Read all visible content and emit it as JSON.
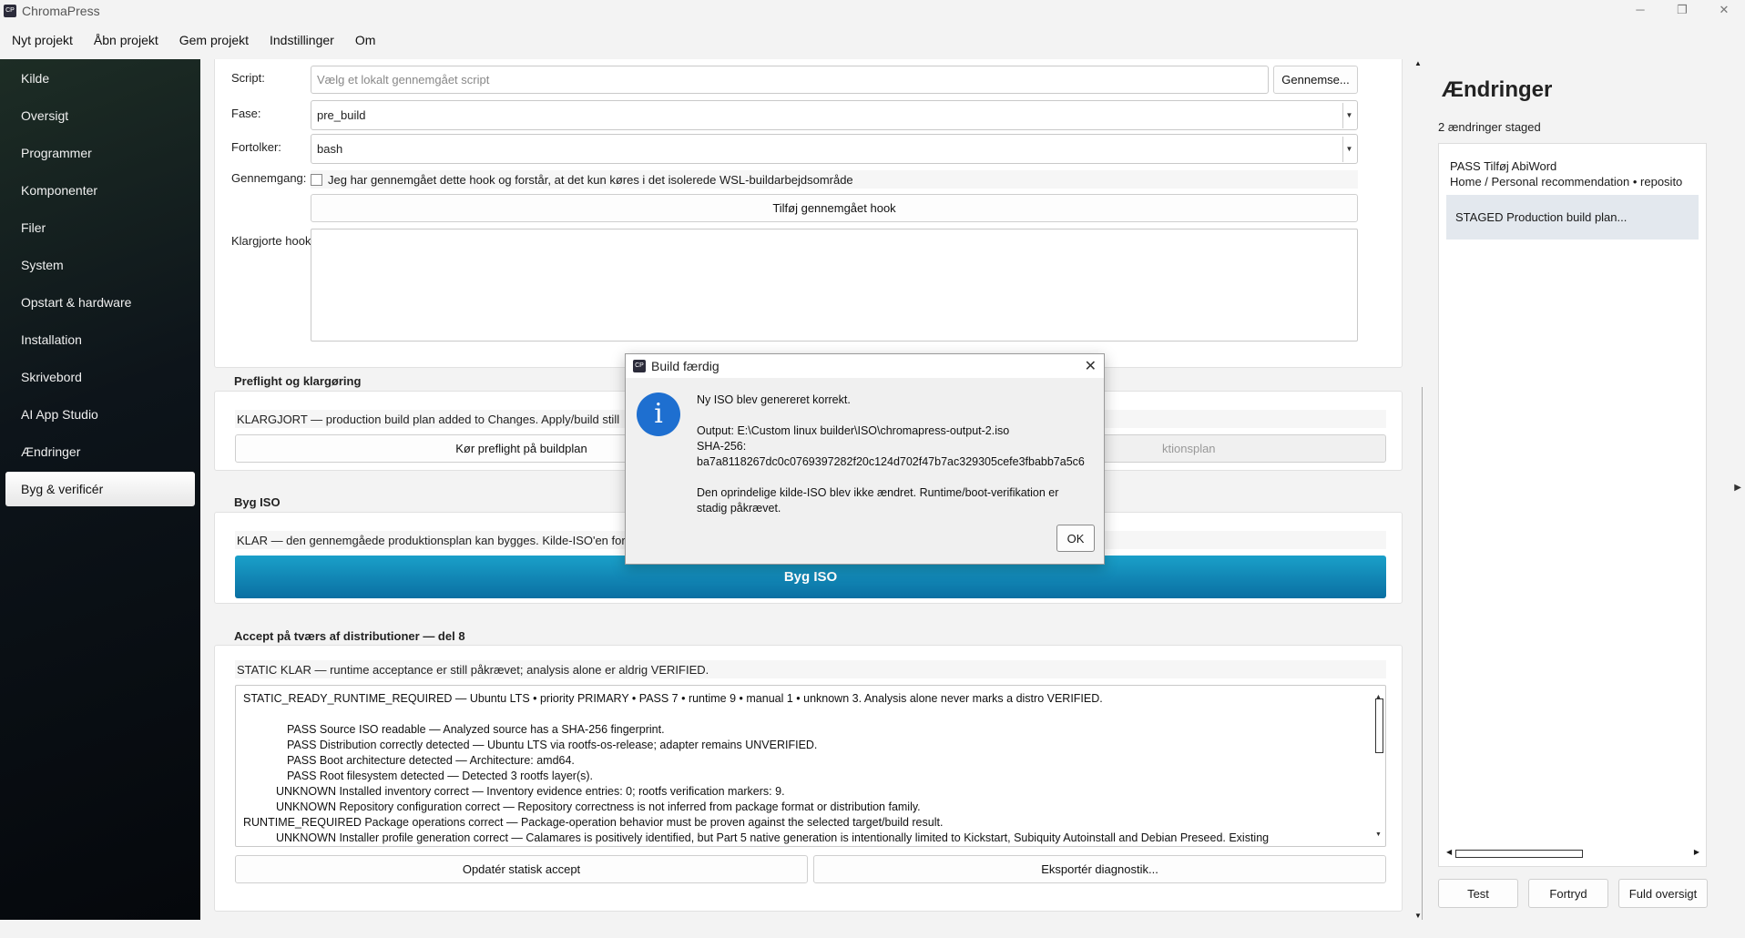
{
  "window": {
    "title": "ChromaPress",
    "controls": [
      "─",
      "❐",
      "✕"
    ]
  },
  "menu": [
    "Nyt projekt",
    "Åbn projekt",
    "Gem projekt",
    "Indstillinger",
    "Om"
  ],
  "sidebar": {
    "items": [
      "Kilde",
      "Oversigt",
      "Programmer",
      "Komponenter",
      "Filer",
      "System",
      "Opstart & hardware",
      "Installation",
      "Skrivebord",
      "AI App Studio",
      "Ændringer",
      "Byg & verificér"
    ],
    "active": "Byg & verificér"
  },
  "hooks": {
    "script_label": "Script:",
    "script_placeholder": "Vælg et lokalt gennemgået script",
    "browse_button": "Gennemse...",
    "phase_label": "Fase:",
    "phase_value": "pre_build",
    "interpreter_label": "Fortolker:",
    "interpreter_value": "bash",
    "review_label": "Gennemgang:",
    "review_checkbox": "Jeg har gennemgået dette hook og forstår, at det kun køres i det isolerede WSL-buildarbejdsområde",
    "add_button": "Tilføj gennemgået hook",
    "prepared_label": "Klargjorte hooks:"
  },
  "preflight": {
    "title": "Preflight og klargøring",
    "status": "KLARGJORT — production build plan added to Changes. Apply/build still",
    "run_button": "Kør preflight på buildplan",
    "plan_button_partial": "ktionsplan"
  },
  "build": {
    "title": "Byg ISO",
    "status": "KLAR — den gennemgåede produktionsplan kan bygges. Kilde-ISO'en for",
    "button": "Byg ISO"
  },
  "accept": {
    "title": "Accept på tværs af distributioner — del 8",
    "status": "STATIC KLAR — runtime acceptance er still påkrævet; analysis alone er aldrig VERIFIED.",
    "lines": [
      "STATIC_READY_RUNTIME_REQUIRED — Ubuntu LTS • priority PRIMARY • PASS 7 • runtime 9 • manual 1 • unknown 3. Analysis alone never marks a distro VERIFIED.",
      "",
      "PASS  Source ISO readable — Analyzed source has a SHA-256 fingerprint.",
      "PASS  Distribution correctly detected — Ubuntu LTS via rootfs-os-release; adapter remains UNVERIFIED.",
      "PASS  Boot architecture detected — Architecture: amd64.",
      "PASS  Root filesystem detected — Detected 3 rootfs layer(s).",
      "UNKNOWN  Installed inventory correct — Inventory evidence entries: 0; rootfs verification markers: 9.",
      "UNKNOWN  Repository configuration correct — Repository correctness is not inferred from package format or distribution family.",
      "RUNTIME_REQUIRED  Package operations correct — Package-operation behavior must be proven against the selected target/build result.",
      "UNKNOWN  Installer profile generation correct — Calamares is positively identified, but Part 5 native generation is intentionally limited to Kickstart, Subiquity Autoinstall and Debian Preseed. Existing"
    ],
    "update_button": "Opdatér statisk accept",
    "export_button": "Eksportér diagnostik..."
  },
  "changes": {
    "title": "Ændringer",
    "count": "2 ændringer staged",
    "items": [
      {
        "line1": "PASS  Tilføj AbiWord",
        "line2": "Home / Personal recommendation • reposito"
      },
      {
        "line1": "STAGED  Production build plan..."
      }
    ],
    "buttons": [
      "Test",
      "Fortryd",
      "Fuld oversigt"
    ]
  },
  "dialog": {
    "title": "Build færdig",
    "close": "✕",
    "icon": "i",
    "message": "Ny ISO blev genereret korrekt.",
    "output": "Output: E:\\Custom linux builder\\ISO\\chromapress-output-2.iso",
    "sha_label": "SHA-256:",
    "sha": "ba7a8118267dc0c0769397282f20c124d702f47b7ac329305cefe3fbabb7a5c6",
    "note1": "Den oprindelige kilde-ISO blev ikke ændret. Runtime/boot-verifikation er",
    "note2": "stadig påkrævet.",
    "ok": "OK"
  }
}
